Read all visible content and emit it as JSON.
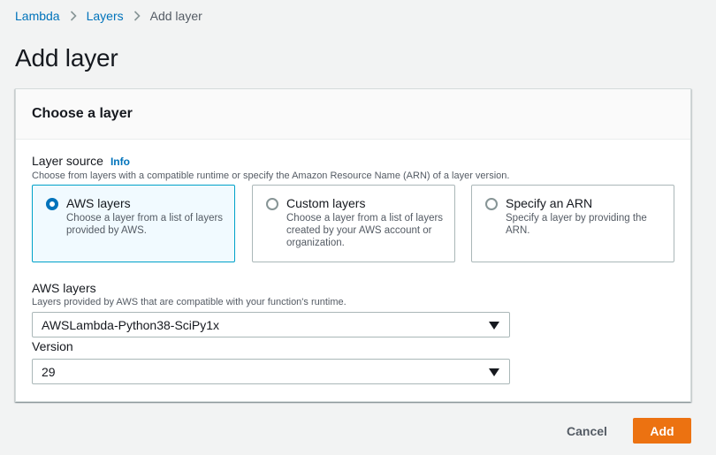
{
  "breadcrumb": {
    "items": [
      "Lambda",
      "Layers"
    ],
    "current": "Add layer"
  },
  "page": {
    "title": "Add layer"
  },
  "panel": {
    "title": "Choose a layer",
    "layer_source": {
      "label": "Layer source",
      "info": "Info",
      "description": "Choose from layers with a compatible runtime or specify the Amazon Resource Name (ARN) of a layer version.",
      "options": [
        {
          "title": "AWS layers",
          "description": "Choose a layer from a list of layers provided by AWS.",
          "selected": true
        },
        {
          "title": "Custom layers",
          "description": "Choose a layer from a list of layers created by your AWS account or organization.",
          "selected": false
        },
        {
          "title": "Specify an ARN",
          "description": "Specify a layer by providing the ARN.",
          "selected": false
        }
      ]
    },
    "aws_layers": {
      "label": "AWS layers",
      "description": "Layers provided by AWS that are compatible with your function's runtime.",
      "value": "AWSLambda-Python38-SciPy1x"
    },
    "version": {
      "label": "Version",
      "value": "29"
    }
  },
  "actions": {
    "cancel": "Cancel",
    "add": "Add"
  },
  "colors": {
    "link": "#0073bb",
    "primary_button": "#ec7211",
    "selected_tile_bg": "#f1faff",
    "selected_tile_border": "#00a1c9"
  }
}
